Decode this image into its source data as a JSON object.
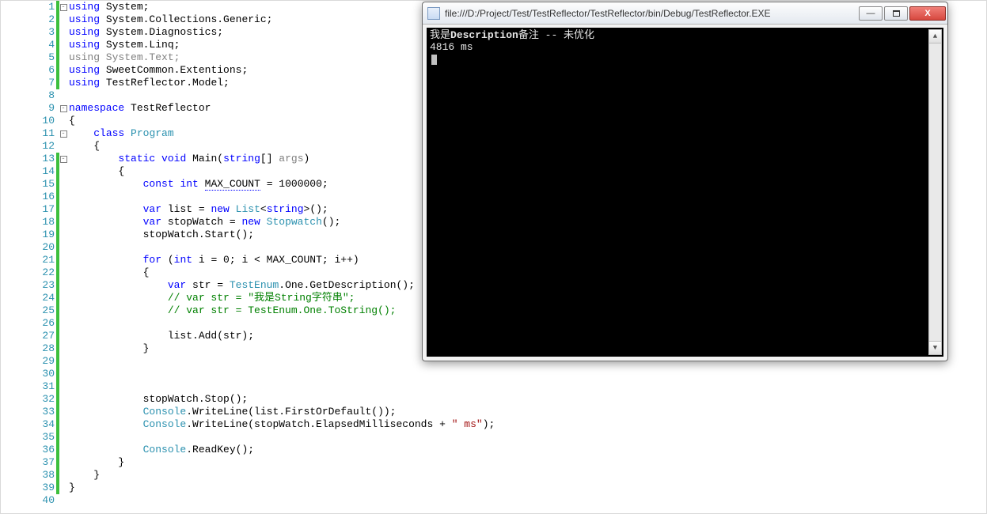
{
  "editor": {
    "lines": [
      {
        "n": 1,
        "mod": "green",
        "fold": "box-minus",
        "tokens": [
          [
            "kw",
            "using"
          ],
          [
            "txt",
            " System;"
          ]
        ]
      },
      {
        "n": 2,
        "mod": "green",
        "tokens": [
          [
            "kw",
            "using"
          ],
          [
            "txt",
            " System.Collections.Generic;"
          ]
        ]
      },
      {
        "n": 3,
        "mod": "green",
        "tokens": [
          [
            "kw",
            "using"
          ],
          [
            "txt",
            " System.Diagnostics;"
          ]
        ]
      },
      {
        "n": 4,
        "mod": "green",
        "tokens": [
          [
            "kw",
            "using"
          ],
          [
            "txt",
            " System.Linq;"
          ]
        ]
      },
      {
        "n": 5,
        "mod": "green",
        "tokens": [
          [
            "dim",
            "using System.Text;"
          ]
        ]
      },
      {
        "n": 6,
        "mod": "green",
        "tokens": [
          [
            "kw",
            "using"
          ],
          [
            "txt",
            " SweetCommon.Extentions;"
          ]
        ]
      },
      {
        "n": 7,
        "mod": "green",
        "tokens": [
          [
            "kw",
            "using"
          ],
          [
            "txt",
            " TestReflector.Model;"
          ]
        ]
      },
      {
        "n": 8,
        "tokens": []
      },
      {
        "n": 9,
        "fold": "box-minus",
        "tokens": [
          [
            "kw",
            "namespace"
          ],
          [
            "txt",
            " TestReflector"
          ]
        ]
      },
      {
        "n": 10,
        "tokens": [
          [
            "txt",
            "{"
          ]
        ]
      },
      {
        "n": 11,
        "fold": "box-minus",
        "tokens": [
          [
            "txt",
            "    "
          ],
          [
            "kw",
            "class"
          ],
          [
            "txt",
            " "
          ],
          [
            "typ",
            "Program"
          ]
        ]
      },
      {
        "n": 12,
        "tokens": [
          [
            "txt",
            "    {"
          ]
        ]
      },
      {
        "n": 13,
        "mod": "green",
        "fold": "box-minus",
        "tokens": [
          [
            "txt",
            "        "
          ],
          [
            "kw",
            "static"
          ],
          [
            "txt",
            " "
          ],
          [
            "kw",
            "void"
          ],
          [
            "txt",
            " Main("
          ],
          [
            "kw",
            "string"
          ],
          [
            "txt",
            "[] "
          ],
          [
            "dim",
            "args"
          ],
          [
            "txt",
            ")"
          ]
        ]
      },
      {
        "n": 14,
        "mod": "green",
        "tokens": [
          [
            "txt",
            "        {"
          ]
        ]
      },
      {
        "n": 15,
        "mod": "green",
        "tokens": [
          [
            "txt",
            "            "
          ],
          [
            "kw",
            "const"
          ],
          [
            "txt",
            " "
          ],
          [
            "kw",
            "int"
          ],
          [
            "txt",
            " "
          ],
          [
            "txt",
            "MAX_COUNT",
            "underline"
          ],
          [
            "txt",
            " = 1000000;"
          ]
        ]
      },
      {
        "n": 16,
        "mod": "green",
        "tokens": []
      },
      {
        "n": 17,
        "mod": "green",
        "tokens": [
          [
            "txt",
            "            "
          ],
          [
            "kw",
            "var"
          ],
          [
            "txt",
            " list = "
          ],
          [
            "kw",
            "new"
          ],
          [
            "txt",
            " "
          ],
          [
            "typ",
            "List"
          ],
          [
            "txt",
            "<"
          ],
          [
            "kw",
            "string"
          ],
          [
            "txt",
            ">();"
          ]
        ]
      },
      {
        "n": 18,
        "mod": "green",
        "tokens": [
          [
            "txt",
            "            "
          ],
          [
            "kw",
            "var"
          ],
          [
            "txt",
            " stopWatch = "
          ],
          [
            "kw",
            "new"
          ],
          [
            "txt",
            " "
          ],
          [
            "typ",
            "Stopwatch"
          ],
          [
            "txt",
            "();"
          ]
        ]
      },
      {
        "n": 19,
        "mod": "green",
        "tokens": [
          [
            "txt",
            "            stopWatch.Start();"
          ]
        ]
      },
      {
        "n": 20,
        "mod": "green",
        "tokens": []
      },
      {
        "n": 21,
        "mod": "green",
        "tokens": [
          [
            "txt",
            "            "
          ],
          [
            "kw",
            "for"
          ],
          [
            "txt",
            " ("
          ],
          [
            "kw",
            "int"
          ],
          [
            "txt",
            " i = 0; i < MAX_COUNT; i++)"
          ]
        ]
      },
      {
        "n": 22,
        "mod": "green",
        "tokens": [
          [
            "txt",
            "            {"
          ]
        ]
      },
      {
        "n": 23,
        "mod": "green",
        "tokens": [
          [
            "txt",
            "                "
          ],
          [
            "kw",
            "var"
          ],
          [
            "txt",
            " str = "
          ],
          [
            "typ",
            "TestEnum"
          ],
          [
            "txt",
            ".One.GetDescription();"
          ]
        ]
      },
      {
        "n": 24,
        "mod": "green",
        "tokens": [
          [
            "txt",
            "                "
          ],
          [
            "com",
            "// var str = \"我是String字符串\";"
          ]
        ]
      },
      {
        "n": 25,
        "mod": "green",
        "tokens": [
          [
            "txt",
            "                "
          ],
          [
            "com",
            "// var str = TestEnum.One.ToString();"
          ]
        ]
      },
      {
        "n": 26,
        "mod": "green",
        "tokens": []
      },
      {
        "n": 27,
        "mod": "green",
        "tokens": [
          [
            "txt",
            "                list.Add(str);"
          ]
        ]
      },
      {
        "n": 28,
        "mod": "green",
        "tokens": [
          [
            "txt",
            "            }"
          ]
        ]
      },
      {
        "n": 29,
        "mod": "green",
        "tokens": []
      },
      {
        "n": 30,
        "mod": "green",
        "tokens": []
      },
      {
        "n": 31,
        "mod": "green",
        "tokens": []
      },
      {
        "n": 32,
        "mod": "green",
        "tokens": [
          [
            "txt",
            "            stopWatch.Stop();"
          ]
        ]
      },
      {
        "n": 33,
        "mod": "green",
        "tokens": [
          [
            "txt",
            "            "
          ],
          [
            "typ",
            "Console"
          ],
          [
            "txt",
            ".WriteLine(list.FirstOrDefault());"
          ]
        ]
      },
      {
        "n": 34,
        "mod": "green",
        "tokens": [
          [
            "txt",
            "            "
          ],
          [
            "typ",
            "Console"
          ],
          [
            "txt",
            ".WriteLine(stopWatch.ElapsedMilliseconds + "
          ],
          [
            "str",
            "\" ms\""
          ],
          [
            "txt",
            ");"
          ]
        ]
      },
      {
        "n": 35,
        "mod": "green",
        "tokens": []
      },
      {
        "n": 36,
        "mod": "green",
        "tokens": [
          [
            "txt",
            "            "
          ],
          [
            "typ",
            "Console"
          ],
          [
            "txt",
            ".ReadKey();"
          ]
        ]
      },
      {
        "n": 37,
        "mod": "green",
        "tokens": [
          [
            "txt",
            "        }"
          ]
        ]
      },
      {
        "n": 38,
        "mod": "green",
        "tokens": [
          [
            "txt",
            "    }"
          ]
        ]
      },
      {
        "n": 39,
        "mod": "green",
        "tokens": [
          [
            "txt",
            "}"
          ]
        ]
      },
      {
        "n": 40,
        "tokens": []
      }
    ]
  },
  "console": {
    "title": "file:///D:/Project/Test/TestReflector/TestReflector/bin/Debug/TestReflector.EXE",
    "output": {
      "line1_prefix": "我是",
      "line1_bold": "Description",
      "line1_suffix": "备注 -- 未优化",
      "line2": "4816 ms"
    },
    "buttons": {
      "min": "—",
      "close": "X"
    }
  }
}
